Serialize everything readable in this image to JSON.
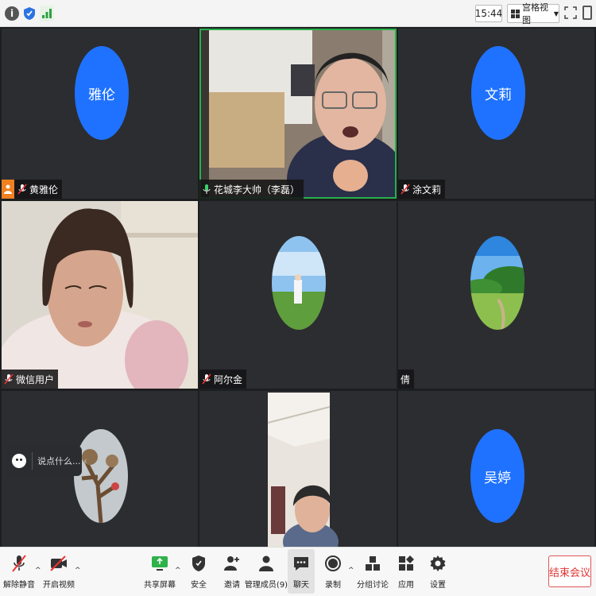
{
  "topbar": {
    "time": "15:44",
    "view_label": "宫格视图"
  },
  "participants": [
    {
      "name": "黄雅伦",
      "avatar_text": "雅伦",
      "type": "avatar",
      "host": true
    },
    {
      "name": "花城李大帅（李磊）",
      "type": "video",
      "active": true
    },
    {
      "name": "涂文莉",
      "avatar_text": "文莉",
      "type": "avatar"
    },
    {
      "name": "微信用户",
      "type": "video"
    },
    {
      "name": "阿尔金",
      "type": "photo-avatar"
    },
    {
      "name": "倩",
      "type": "photo-avatar"
    },
    {
      "name": "",
      "type": "photo-avatar"
    },
    {
      "name": "",
      "type": "video"
    },
    {
      "name": "",
      "avatar_text": "吴婷",
      "type": "avatar"
    }
  ],
  "chat_bubble": {
    "placeholder": "说点什么..."
  },
  "toolbar": {
    "unmute": "解除静音",
    "start_video": "开启视频",
    "share_screen": "共享屏幕",
    "security": "安全",
    "invite": "邀请",
    "members": "管理成员(9)",
    "chat": "聊天",
    "record": "录制",
    "breakout": "分组讨论",
    "apps": "应用",
    "settings": "设置",
    "end_meeting": "结束会议"
  },
  "colors": {
    "avatar_blue": "#1f72ff",
    "active_speaker": "#27b04b",
    "host_badge": "#f08020",
    "end_red": "#e03333"
  }
}
